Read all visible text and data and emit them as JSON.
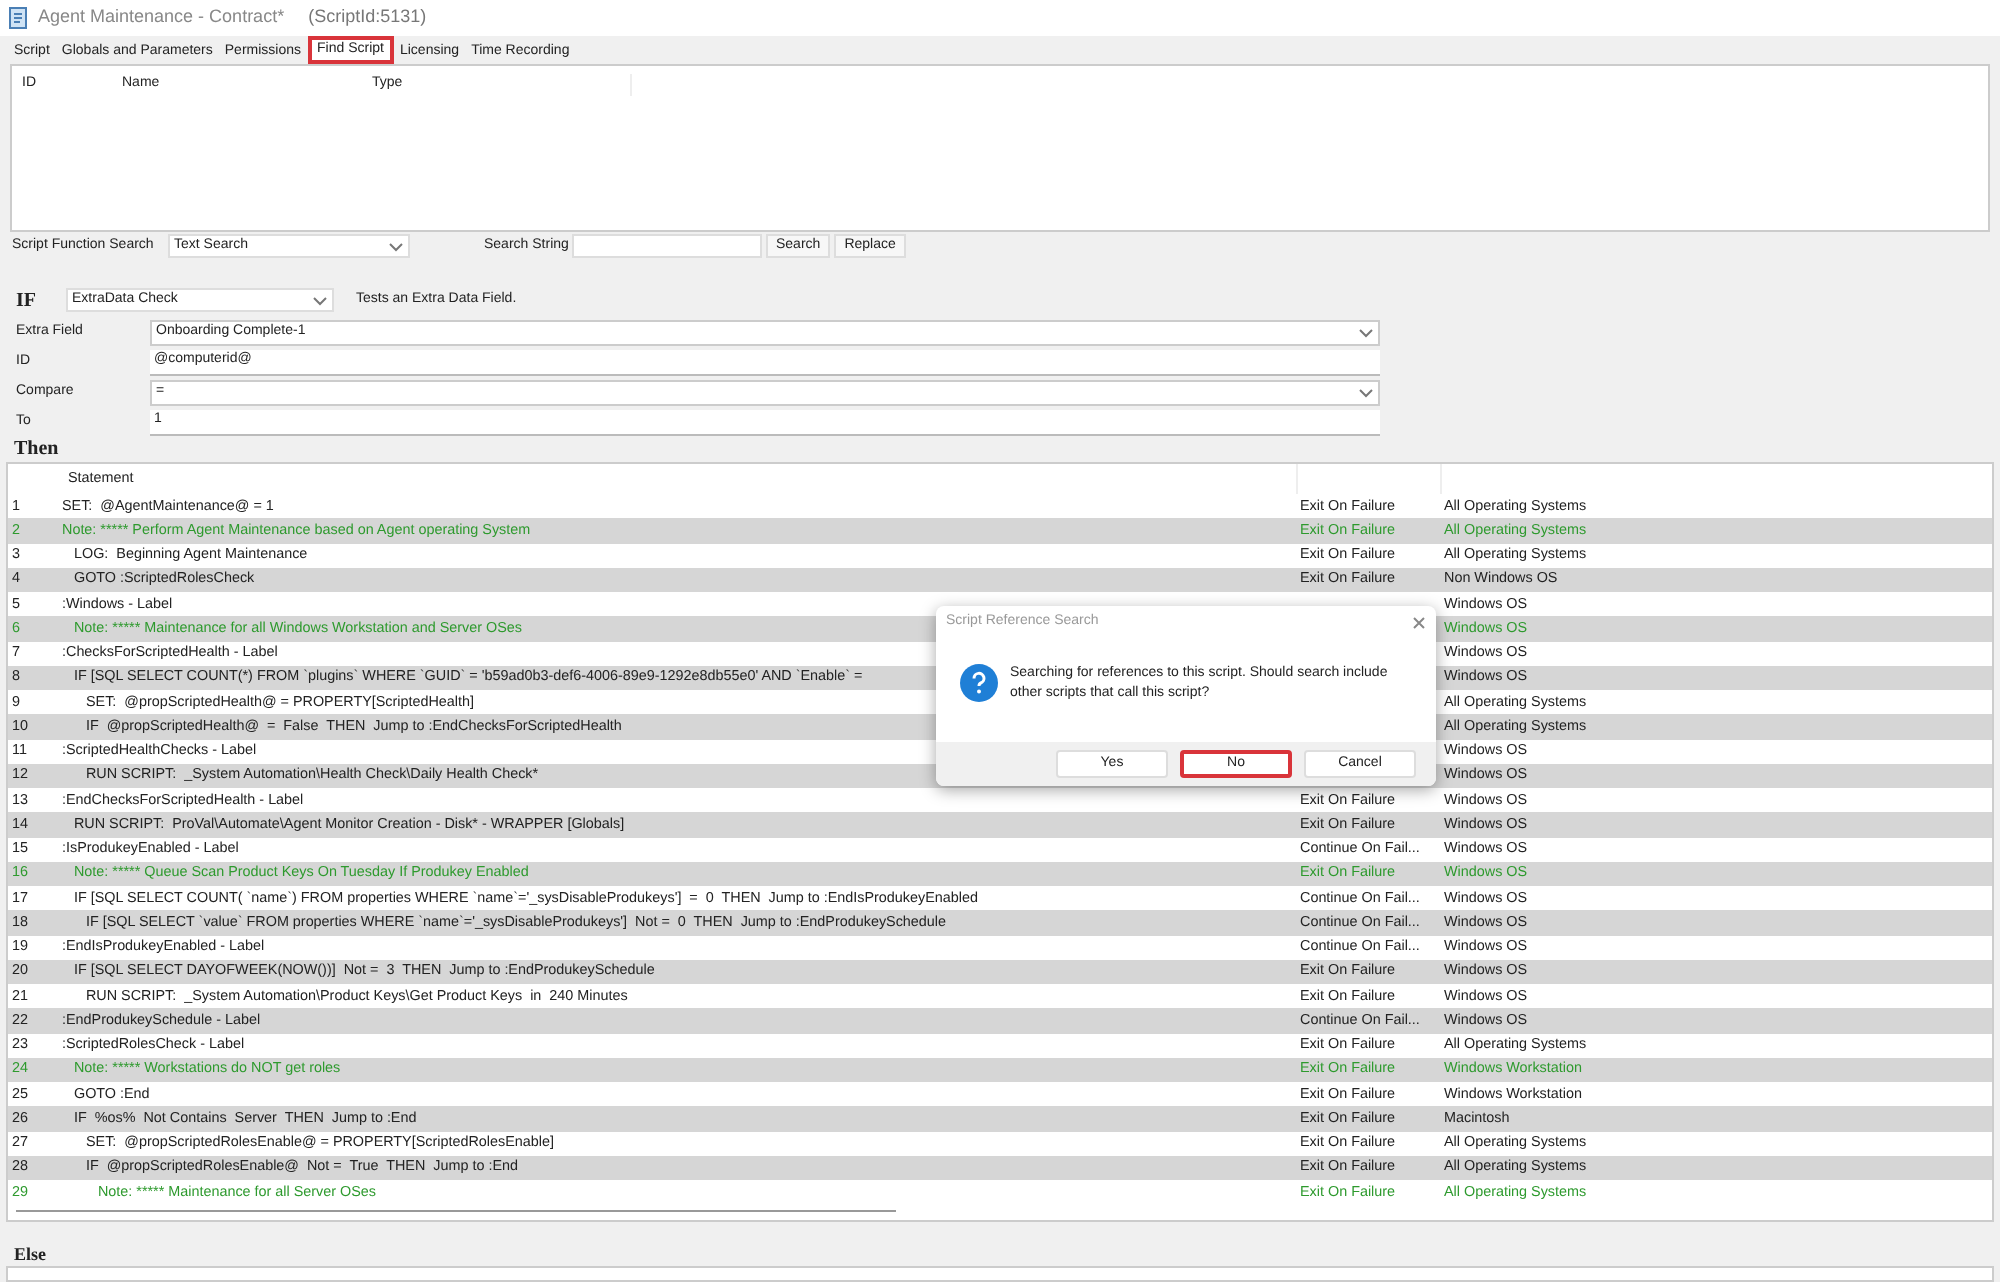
{
  "window": {
    "title": "Agent Maintenance - Contract*",
    "subtitle": "(ScriptId:5131)"
  },
  "tabs": [
    {
      "label": "Script",
      "selected": false
    },
    {
      "label": "Globals and Parameters",
      "selected": false
    },
    {
      "label": "Permissions",
      "selected": false
    },
    {
      "label": "Find Script",
      "selected": true
    },
    {
      "label": "Licensing",
      "selected": false
    },
    {
      "label": "Time Recording",
      "selected": false
    }
  ],
  "find_table": {
    "columns": [
      "ID",
      "Name",
      "Type"
    ]
  },
  "search_bar": {
    "label": "Script Function Search",
    "mode": "Text Search",
    "string_label": "Search String",
    "buttons": [
      "Search",
      "Replace"
    ]
  },
  "if_section": {
    "heading": "IF",
    "function": "ExtraData Check",
    "description": "Tests an Extra Data Field.",
    "fields": [
      {
        "label": "Extra Field",
        "value": "Onboarding Complete-1",
        "kind": "dropdown"
      },
      {
        "label": "ID",
        "value": "@computerid@",
        "kind": "text"
      },
      {
        "label": "Compare",
        "value": "=",
        "kind": "dropdown"
      },
      {
        "label": "To",
        "value": "1",
        "kind": "text"
      }
    ]
  },
  "then_heading": "Then",
  "statements": {
    "header": "Statement",
    "rows": [
      {
        "number": "1",
        "statement": "SET:  @AgentMaintenance@ = 1",
        "failure": "Exit On Failure",
        "os": "All Operating Systems",
        "kind": "step"
      },
      {
        "number": "2",
        "statement": "Note: ***** Perform Agent Maintenance based on Agent operating System",
        "failure": "Exit On Failure",
        "os": "All Operating Systems",
        "kind": "note"
      },
      {
        "number": "3",
        "statement": "   LOG:  Beginning Agent Maintenance",
        "failure": "Exit On Failure",
        "os": "All Operating Systems",
        "kind": "step"
      },
      {
        "number": "4",
        "statement": "   GOTO :ScriptedRolesCheck",
        "failure": "Exit On Failure",
        "os": "Non Windows OS",
        "kind": "step"
      },
      {
        "number": "5",
        "statement": ":Windows - Label",
        "os": "Windows OS",
        "kind": "step"
      },
      {
        "number": "6",
        "statement": "   Note: ***** Maintenance for all Windows Workstation and Server OSes",
        "os": "Windows OS",
        "kind": "note"
      },
      {
        "number": "7",
        "statement": ":ChecksForScriptedHealth - Label",
        "os": "Windows OS",
        "kind": "step"
      },
      {
        "number": "8",
        "statement": "   IF [SQL SELECT COUNT(*) FROM `plugins` WHERE `GUID` = 'b59ad0b3-def6-4006-89e9-1292e8db55e0' AND `Enable` =",
        "os": "Windows OS",
        "kind": "step"
      },
      {
        "number": "9",
        "statement": "      SET:  @propScriptedHealth@ = PROPERTY[ScriptedHealth]",
        "os": "All Operating Systems",
        "kind": "step"
      },
      {
        "number": "10",
        "statement": "      IF  @propScriptedHealth@  =  False  THEN  Jump to :EndChecksForScriptedHealth",
        "os": "All Operating Systems",
        "kind": "step"
      },
      {
        "number": "11",
        "statement": ":ScriptedHealthChecks - Label",
        "os": "Windows OS",
        "kind": "step"
      },
      {
        "number": "12",
        "statement": "      RUN SCRIPT:  _System Automation\\Health Check\\Daily Health Check*",
        "os": "Windows OS",
        "kind": "step"
      },
      {
        "number": "13",
        "statement": ":EndChecksForScriptedHealth - Label",
        "failure": "Exit On Failure",
        "os": "Windows OS",
        "kind": "step"
      },
      {
        "number": "14",
        "statement": "   RUN SCRIPT:  ProVal\\Automate\\Agent Monitor Creation - Disk* - WRAPPER [Globals]",
        "failure": "Exit On Failure",
        "os": "Windows OS",
        "kind": "step"
      },
      {
        "number": "15",
        "statement": ":IsProdukeyEnabled - Label",
        "failure": "Continue On Fail...",
        "os": "Windows OS",
        "kind": "step"
      },
      {
        "number": "16",
        "statement": "   Note: ***** Queue Scan Product Keys On Tuesday If Produkey Enabled",
        "failure": "Exit On Failure",
        "os": "Windows OS",
        "kind": "note"
      },
      {
        "number": "17",
        "statement": "   IF [SQL SELECT COUNT( `name`) FROM properties WHERE `name`='_sysDisableProdukeys']  =  0  THEN  Jump to :EndIsProdukeyEnabled",
        "failure": "Continue On Fail...",
        "os": "Windows OS",
        "kind": "step"
      },
      {
        "number": "18",
        "statement": "      IF [SQL SELECT `value` FROM properties WHERE `name`='_sysDisableProdukeys']  Not =  0  THEN  Jump to :EndProdukeySchedule",
        "failure": "Continue On Fail...",
        "os": "Windows OS",
        "kind": "step"
      },
      {
        "number": "19",
        "statement": ":EndIsProdukeyEnabled - Label",
        "failure": "Continue On Fail...",
        "os": "Windows OS",
        "kind": "step"
      },
      {
        "number": "20",
        "statement": "   IF [SQL SELECT DAYOFWEEK(NOW())]  Not =  3  THEN  Jump to :EndProdukeySchedule",
        "failure": "Exit On Failure",
        "os": "Windows OS",
        "kind": "step"
      },
      {
        "number": "21",
        "statement": "      RUN SCRIPT:  _System Automation\\Product Keys\\Get Product Keys  in  240 Minutes",
        "failure": "Exit On Failure",
        "os": "Windows OS",
        "kind": "step"
      },
      {
        "number": "22",
        "statement": ":EndProdukeySchedule - Label",
        "failure": "Continue On Fail...",
        "os": "Windows OS",
        "kind": "step"
      },
      {
        "number": "23",
        "statement": ":ScriptedRolesCheck - Label",
        "failure": "Exit On Failure",
        "os": "All Operating Systems",
        "kind": "step"
      },
      {
        "number": "24",
        "statement": "   Note: ***** Workstations do NOT get roles",
        "failure": "Exit On Failure",
        "os": "Windows Workstation",
        "kind": "note"
      },
      {
        "number": "25",
        "statement": "   GOTO :End",
        "failure": "Exit On Failure",
        "os": "Windows Workstation",
        "kind": "step"
      },
      {
        "number": "26",
        "statement": "   IF  %os%  Not Contains  Server  THEN  Jump to :End",
        "failure": "Exit On Failure",
        "os": "Macintosh",
        "kind": "step"
      },
      {
        "number": "27",
        "statement": "      SET:  @propScriptedRolesEnable@ = PROPERTY[ScriptedRolesEnable]",
        "failure": "Exit On Failure",
        "os": "All Operating Systems",
        "kind": "step"
      },
      {
        "number": "28",
        "statement": "      IF  @propScriptedRolesEnable@  Not =  True  THEN  Jump to :End",
        "failure": "Exit On Failure",
        "os": "All Operating Systems",
        "kind": "step"
      },
      {
        "number": "29",
        "statement": "         Note: ***** Maintenance for all Server OSes",
        "failure": "Exit On Failure",
        "os": "All Operating Systems",
        "kind": "note"
      }
    ]
  },
  "else_heading": "Else",
  "dialog": {
    "title": "Script Reference Search",
    "message": "Searching for references to this script. Should search include other scripts that call this script?",
    "buttons": [
      {
        "label": "Yes",
        "highlighted": false
      },
      {
        "label": "No",
        "highlighted": true
      },
      {
        "label": "Cancel",
        "highlighted": false
      }
    ]
  }
}
